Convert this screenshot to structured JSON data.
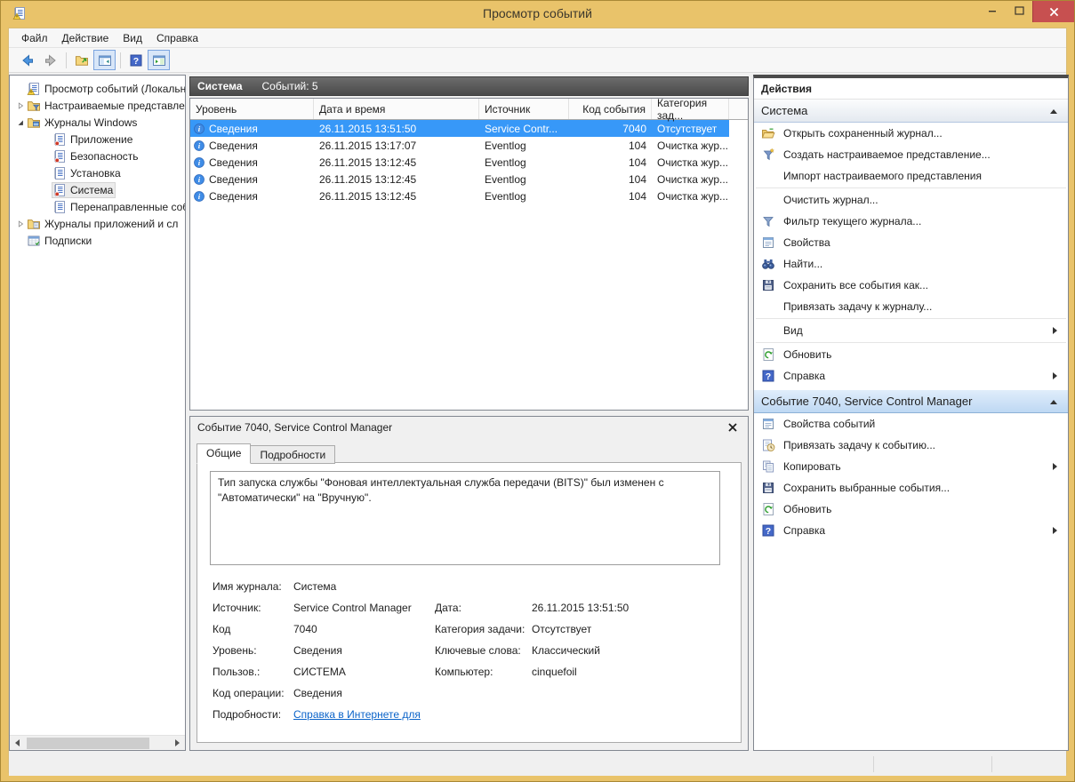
{
  "window": {
    "title": "Просмотр событий",
    "app_icon": "event-viewer-icon",
    "controls": [
      {
        "name": "minimize"
      },
      {
        "name": "maximize"
      },
      {
        "name": "close"
      }
    ]
  },
  "colors": {
    "titlebar_gold": "#e9c36a",
    "close_button_red": "#c75050",
    "selection_blue": "#3798f8",
    "link_blue": "#0a63c9",
    "list_caption_dark": "#4a4a4a"
  },
  "menu": {
    "items": [
      "Файл",
      "Действие",
      "Вид",
      "Справка"
    ]
  },
  "toolbar": {
    "buttons": [
      {
        "icon": "back-arrow-icon"
      },
      {
        "icon": "forward-arrow-icon"
      },
      {
        "icon": "export-log-folder-icon"
      },
      {
        "icon": "toggle-console-tree-icon",
        "active": true
      },
      {
        "icon": "help-icon"
      },
      {
        "icon": "toggle-action-pane-icon",
        "active": true
      }
    ]
  },
  "tree": {
    "items": [
      {
        "label": "Просмотр событий (Локальнь",
        "icon": "event-viewer-icon",
        "depth": 0
      },
      {
        "label": "Настраиваемые представле",
        "icon": "custom-views-folder-icon",
        "depth": 1,
        "expander": "collapsed"
      },
      {
        "label": "Журналы Windows",
        "icon": "windows-logs-folder-icon",
        "depth": 1,
        "expander": "expanded"
      },
      {
        "label": "Приложение",
        "icon": "log-icon",
        "depth": 2
      },
      {
        "label": "Безопасность",
        "icon": "log-icon",
        "depth": 2
      },
      {
        "label": "Установка",
        "icon": "log-plain-icon",
        "depth": 2
      },
      {
        "label": "Система",
        "icon": "log-icon",
        "depth": 2,
        "selected": true
      },
      {
        "label": "Перенаправленные соб",
        "icon": "log-plain-icon",
        "depth": 2
      },
      {
        "label": "Журналы приложений и сл",
        "icon": "app-logs-folder-icon",
        "depth": 1,
        "expander": "collapsed"
      },
      {
        "label": "Подписки",
        "icon": "subscriptions-icon",
        "depth": 1
      }
    ]
  },
  "list": {
    "caption": {
      "title": "Система",
      "count_label": "Событий: 5"
    },
    "columns": [
      "Уровень",
      "Дата и время",
      "Источник",
      "Код события",
      "Категория зад..."
    ],
    "rows": [
      {
        "level": "Сведения",
        "datetime": "26.11.2015 13:51:50",
        "source": "Service Contr...",
        "event_id": "7040",
        "category": "Отсутствует",
        "selected": true
      },
      {
        "level": "Сведения",
        "datetime": "26.11.2015 13:17:07",
        "source": "Eventlog",
        "event_id": "104",
        "category": "Очистка жур...",
        "selected": false
      },
      {
        "level": "Сведения",
        "datetime": "26.11.2015 13:12:45",
        "source": "Eventlog",
        "event_id": "104",
        "category": "Очистка жур...",
        "selected": false
      },
      {
        "level": "Сведения",
        "datetime": "26.11.2015 13:12:45",
        "source": "Eventlog",
        "event_id": "104",
        "category": "Очистка жур...",
        "selected": false
      },
      {
        "level": "Сведения",
        "datetime": "26.11.2015 13:12:45",
        "source": "Eventlog",
        "event_id": "104",
        "category": "Очистка жур...",
        "selected": false
      }
    ]
  },
  "detail": {
    "header": "Событие 7040, Service Control Manager",
    "tabs": [
      {
        "label": "Общие",
        "active": true
      },
      {
        "label": "Подробности",
        "active": false
      }
    ],
    "message": "Тип запуска службы \"Фоновая интеллектуальная служба передачи (BITS)\" был изменен с \"Автоматически\" на \"Вручную\".",
    "fields_left": [
      {
        "label": "Имя журнала:",
        "value": "Система"
      },
      {
        "label": "Источник:",
        "value": "Service Control Manager"
      },
      {
        "label": "Код",
        "value": "7040"
      },
      {
        "label": "Уровень:",
        "value": "Сведения"
      },
      {
        "label": "Пользов.:",
        "value": "СИСТЕМА"
      },
      {
        "label": "Код операции:",
        "value": "Сведения"
      },
      {
        "label": "Подробности:",
        "value": "Справка в Интернете для "
      }
    ],
    "fields_right": [
      {
        "label": "Дата:",
        "value": "26.11.2015 13:51:50"
      },
      {
        "label": "Категория задачи:",
        "value": "Отсутствует"
      },
      {
        "label": "Ключевые слова:",
        "value": "Классический"
      },
      {
        "label": "Компьютер:",
        "value": "cinquefoil"
      }
    ]
  },
  "actions": {
    "title": "Действия",
    "sections": [
      {
        "title": "Система",
        "items": [
          {
            "label": "Открыть сохраненный журнал...",
            "icon": "open-folder-icon"
          },
          {
            "label": "Создать настраиваемое представление...",
            "icon": "create-view-filter-icon"
          },
          {
            "label": "Импорт настраиваемого представления"
          },
          {
            "label": "Очистить журнал..."
          },
          {
            "label": "Фильтр текущего журнала...",
            "icon": "filter-icon"
          },
          {
            "label": "Свойства",
            "icon": "properties-icon"
          },
          {
            "label": "Найти...",
            "icon": "find-binoculars-icon"
          },
          {
            "label": "Сохранить все события как...",
            "icon": "save-icon"
          },
          {
            "label": "Привязать задачу к журналу..."
          },
          {
            "label": "Вид",
            "submenu": true
          },
          {
            "label": "Обновить",
            "icon": "refresh-icon"
          },
          {
            "label": "Справка",
            "icon": "help-icon",
            "submenu": true
          }
        ]
      },
      {
        "title": "Событие 7040, Service Control Manager",
        "items": [
          {
            "label": "Свойства событий",
            "icon": "properties-icon"
          },
          {
            "label": "Привязать задачу к событию...",
            "icon": "attach-task-icon"
          },
          {
            "label": "Копировать",
            "icon": "copy-icon",
            "submenu": true
          },
          {
            "label": "Сохранить выбранные события...",
            "icon": "save-icon"
          },
          {
            "label": "Обновить",
            "icon": "refresh-icon"
          },
          {
            "label": "Справка",
            "icon": "help-icon",
            "submenu": true
          }
        ]
      }
    ]
  }
}
